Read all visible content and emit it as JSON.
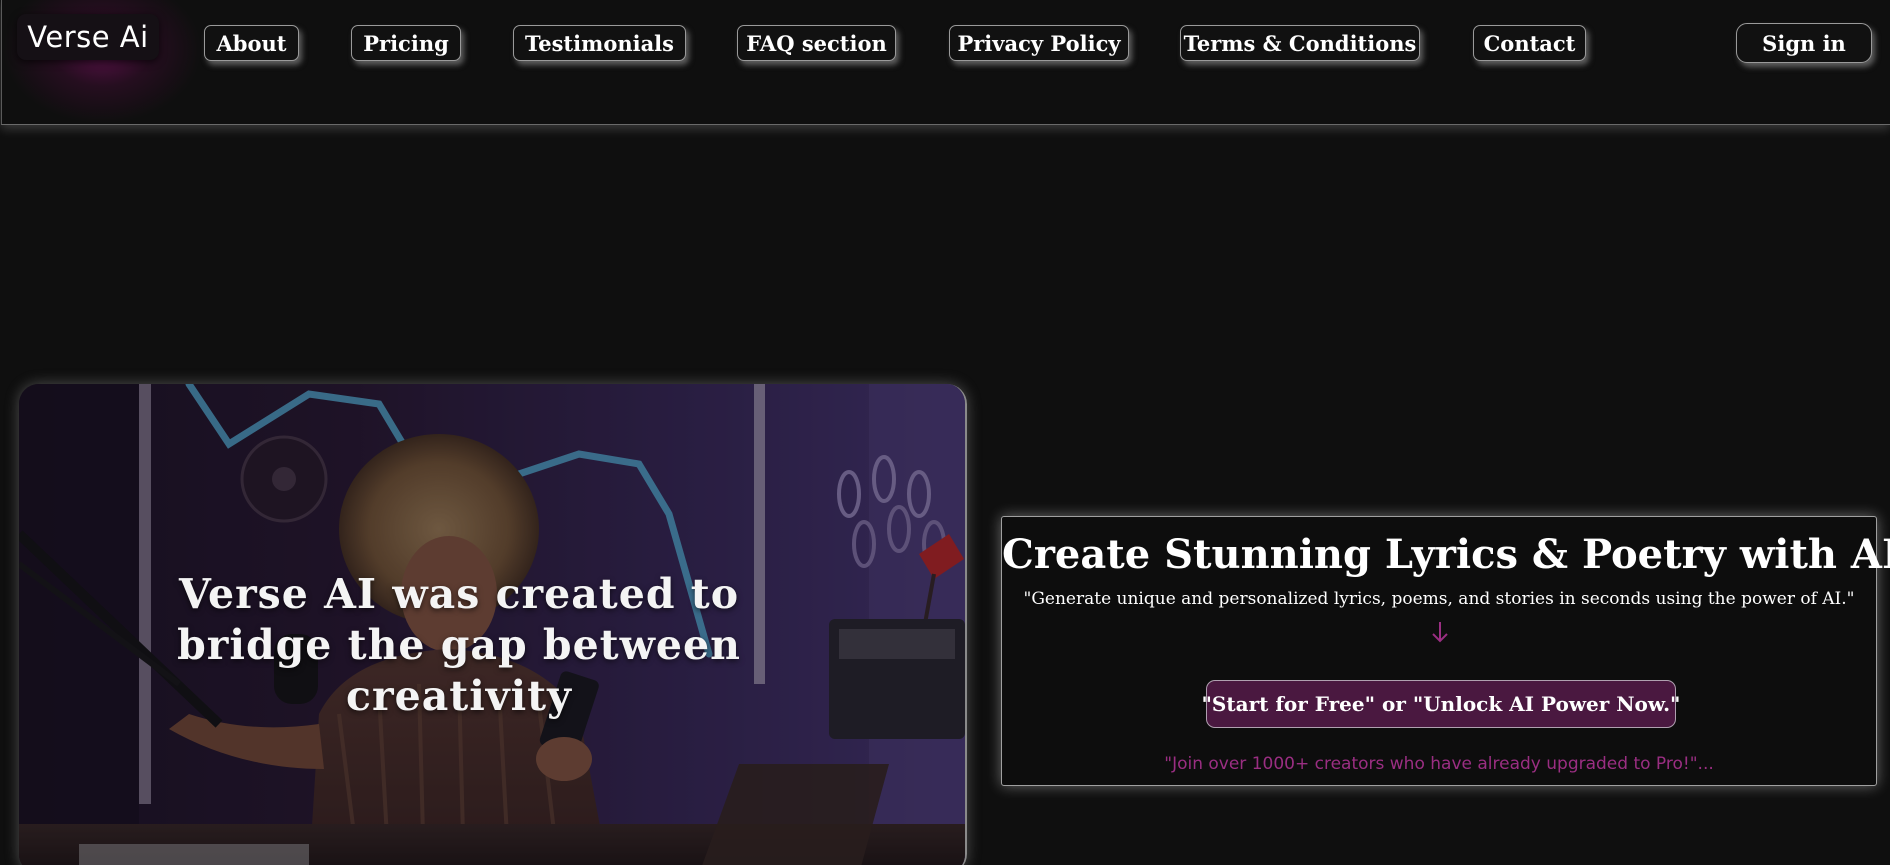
{
  "brand": {
    "logo_text": "Verse Ai"
  },
  "nav": {
    "items": [
      {
        "label": "About"
      },
      {
        "label": "Pricing"
      },
      {
        "label": "Testimonials"
      },
      {
        "label": "FAQ section"
      },
      {
        "label": "Privacy Policy"
      },
      {
        "label": "Terms & Conditions"
      },
      {
        "label": "Contact"
      }
    ],
    "signin_label": "Sign in"
  },
  "hero": {
    "headline": "Verse AI was created to bridge the gap between creativity"
  },
  "cta": {
    "title": "Create Stunning Lyrics & Poetry with AI!",
    "subtitle": "\"Generate unique and personalized lyrics, poems, and stories in seconds using the power of AI.\"",
    "arrow_icon": "arrow-down-icon",
    "button_label": "\"Start for Free\" or \"Unlock AI Power Now.\"",
    "join_text": "\"Join over 1000+ creators who have already upgraded to Pro!\"..."
  },
  "colors": {
    "background": "#0f0f0f",
    "accent_purple": "#4a1840",
    "join_text_pink": "#9a2e82",
    "glow_purple": "#96147a"
  }
}
